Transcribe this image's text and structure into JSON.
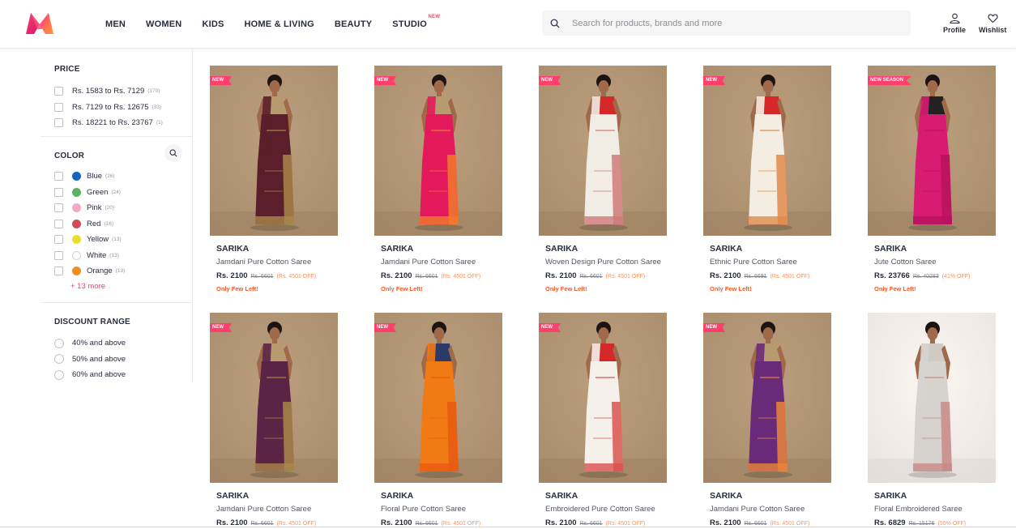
{
  "header": {
    "logo_icon": "myntra-logo",
    "nav": [
      {
        "label": "MEN"
      },
      {
        "label": "WOMEN"
      },
      {
        "label": "KIDS"
      },
      {
        "label": "HOME & LIVING"
      },
      {
        "label": "BEAUTY"
      },
      {
        "label": "STUDIO",
        "badge": "NEW"
      }
    ],
    "search_placeholder": "Search for products, brands and more",
    "profile_label": "Profile",
    "wishlist_label": "Wishlist"
  },
  "filters": {
    "price": {
      "title": "PRICE",
      "options": [
        {
          "label": "Rs. 1583 to Rs. 7129",
          "count": "(170)"
        },
        {
          "label": "Rs. 7129 to Rs. 12675",
          "count": "(33)"
        },
        {
          "label": "Rs. 18221 to Rs. 23767",
          "count": "(1)"
        }
      ]
    },
    "color": {
      "title": "COLOR",
      "options": [
        {
          "label": "Blue",
          "count": "(26)",
          "color": "#1565c0"
        },
        {
          "label": "Green",
          "count": "(24)",
          "color": "#5eb160"
        },
        {
          "label": "Pink",
          "count": "(20)",
          "color": "#f1a9c4"
        },
        {
          "label": "Red",
          "count": "(16)",
          "color": "#d34b56"
        },
        {
          "label": "Yellow",
          "count": "(13)",
          "color": "#eadc32"
        },
        {
          "label": "White",
          "count": "(13)",
          "color": "#ffffff"
        },
        {
          "label": "Orange",
          "count": "(13)",
          "color": "#f28d20"
        }
      ],
      "more": "+ 13 more"
    },
    "discount": {
      "title": "DISCOUNT RANGE",
      "options": [
        {
          "label": "40% and above"
        },
        {
          "label": "50% and above"
        },
        {
          "label": "60% and above"
        }
      ]
    }
  },
  "products": [
    {
      "tag": "NEW",
      "brand": "SARIKA",
      "name": "Jamdani Pure Cotton Saree",
      "price": "Rs. 2100",
      "mrp": "Rs. 6601",
      "off": "(Rs. 4501 OFF)",
      "stock": "Only Few Left!",
      "bg": "#a88c6c",
      "saree": "#5a1f2a",
      "accent": "#a8874a",
      "blouse": "#b89a70"
    },
    {
      "tag": "NEW",
      "brand": "SARIKA",
      "name": "Jamdani Pure Cotton Saree",
      "price": "Rs. 2100",
      "mrp": "Rs. 6601",
      "off": "(Rs. 4501 OFF)",
      "stock": "Only Few Left!",
      "bg": "#a88c6c",
      "saree": "#e3195b",
      "accent": "#f07a2a",
      "blouse": "#b89a70"
    },
    {
      "tag": "NEW",
      "brand": "SARIKA",
      "name": "Woven Design Pure Cotton Saree",
      "price": "Rs. 2100",
      "mrp": "Rs. 6601",
      "off": "(Rs. 4501 OFF)",
      "stock": "Only Few Left!",
      "bg": "#a88c6c",
      "saree": "#f1ece4",
      "accent": "#d07a7a",
      "blouse": "#d62828"
    },
    {
      "tag": "NEW",
      "brand": "SARIKA",
      "name": "Ethnic Pure Cotton Saree",
      "price": "Rs. 2100",
      "mrp": "Rs. 6691",
      "off": "(Rs. 4501 OFF)",
      "stock": "Only Few Left!",
      "bg": "#a88c6c",
      "saree": "#f3ede2",
      "accent": "#e08a4a",
      "blouse": "#d62828"
    },
    {
      "tag": "NEW SEASON",
      "brand": "SARIKA",
      "name": "Jute Cotton Saree",
      "price": "Rs. 23766",
      "mrp": "Rs. 40283",
      "off": "(41% OFF)",
      "stock": "Only Few Left!",
      "bg": "#a88c6c",
      "saree": "#d81b73",
      "accent": "#b8125e",
      "blouse": "#222222"
    },
    {
      "tag": "NEW",
      "brand": "SARIKA",
      "name": "Jamdani Pure Cotton Saree",
      "price": "Rs. 2100",
      "mrp": "Rs. 6601",
      "off": "(Rs. 4501 OFF)",
      "stock": "",
      "bg": "#a88c6c",
      "saree": "#5b2346",
      "accent": "#a8874a",
      "blouse": "#b89a70"
    },
    {
      "tag": "NEW",
      "brand": "SARIKA",
      "name": "Floral Pure Cotton Saree",
      "price": "Rs. 2100",
      "mrp": "Rs. 6601",
      "off": "(Rs. 4501 OFF)",
      "stock": "",
      "bg": "#a88c6c",
      "saree": "#f27a14",
      "accent": "#e85a10",
      "blouse": "#2a3a6a"
    },
    {
      "tag": "NEW",
      "brand": "SARIKA",
      "name": "Embroidered Pure Cotton Saree",
      "price": "Rs. 2100",
      "mrp": "Rs. 6601",
      "off": "(Rs. 4501 OFF)",
      "stock": "",
      "bg": "#a88c6c",
      "saree": "#f5f0ea",
      "accent": "#d9534f",
      "blouse": "#d62828"
    },
    {
      "tag": "NEW",
      "brand": "SARIKA",
      "name": "Jamdani Pure Cotton Saree",
      "price": "Rs. 2100",
      "mrp": "Rs. 6601",
      "off": "(Rs. 4501 OFF)",
      "stock": "",
      "bg": "#a88c6c",
      "saree": "#6a2a7a",
      "accent": "#e8843a",
      "blouse": "#b89a70"
    },
    {
      "tag": "",
      "brand": "SARIKA",
      "name": "Floral Embroidered Saree",
      "price": "Rs. 6829",
      "mrp": "Rs. 15176",
      "off": "(55% OFF)",
      "stock": "",
      "bg": "#e9e4df",
      "saree": "#d6d3cf",
      "accent": "#c98a86",
      "blouse": "#cfcac4"
    }
  ],
  "colors": {
    "accent": "#ff3f6c",
    "discount": "#ff905a",
    "stock": "#ff5722"
  }
}
